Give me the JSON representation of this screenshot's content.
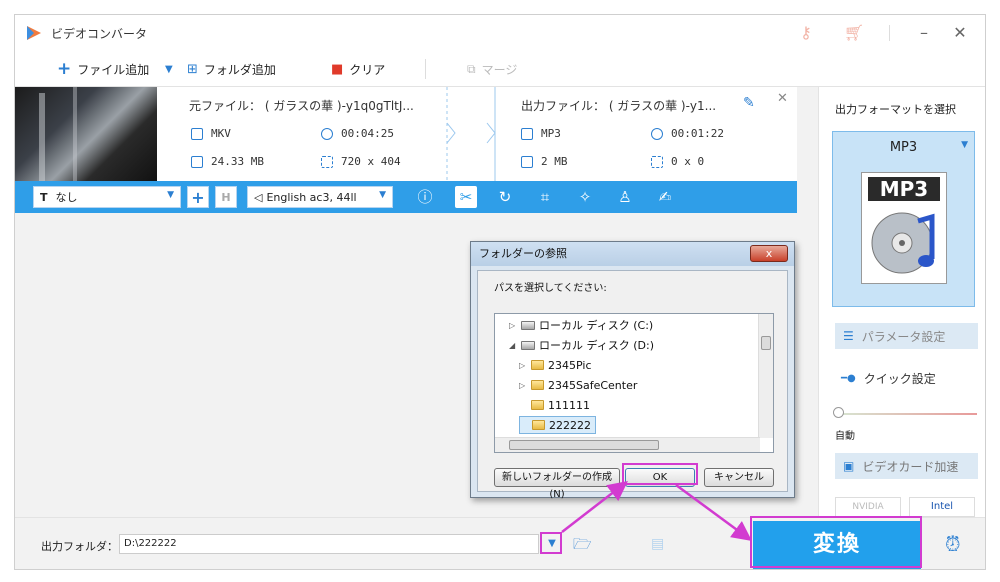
{
  "window": {
    "title": "ビデオコンバータ"
  },
  "toolbar": {
    "add_file": "ファイル追加",
    "add_folder": "フォルダ追加",
    "clear": "クリア",
    "merge": "マージ"
  },
  "file": {
    "source_label": "元ファイル： ( ガラスの華 )-y1q0gTltJ...",
    "source_format": "MKV",
    "source_duration": "00:04:25",
    "source_size": "24.33 MB",
    "source_resolution": "720 x 404",
    "output_label": "出力ファイル： ( ガラスの華 )-y1...",
    "output_format": "MP3",
    "output_duration": "00:01:22",
    "output_size": "2 MB",
    "output_resolution": "0 x 0"
  },
  "editbar": {
    "subtitle": "なし",
    "audio_track": "English ac3, 44ll"
  },
  "right_panel": {
    "format_heading": "出力フォーマットを選択",
    "format_name": "MP3",
    "format_badge": "MP3",
    "parameter_settings": "パラメータ設定",
    "quick_settings": "クイック設定",
    "auto_label": "自動",
    "gpu_accel": "ビデオカード加速",
    "nvidia": "NVIDIA",
    "intel": "Intel"
  },
  "bottom": {
    "output_folder_label": "出力フォルダ：",
    "output_folder_value": "D:\\222222",
    "convert": "変換"
  },
  "dialog": {
    "title": "フォルダーの参照",
    "close": "x",
    "instruction": "パスを選択してください:",
    "tree": [
      {
        "label": "ローカル ディスク (C:)",
        "type": "drive",
        "level": 1,
        "expander": "▷"
      },
      {
        "label": "ローカル ディスク (D:)",
        "type": "drive",
        "level": 1,
        "expander": "◢"
      },
      {
        "label": "2345Pic",
        "type": "folder",
        "level": 2,
        "expander": "▷"
      },
      {
        "label": "2345SafeCenter",
        "type": "folder",
        "level": 2,
        "expander": "▷"
      },
      {
        "label": "111111",
        "type": "folder",
        "level": 2,
        "expander": ""
      },
      {
        "label": "222222",
        "type": "folder",
        "level": 2,
        "expander": "",
        "selected": true
      }
    ],
    "new_folder": "新しいフォルダーの作成(N)",
    "ok": "OK",
    "cancel": "キャンセル"
  },
  "colors": {
    "accent": "#2f9ee8",
    "convert_bg": "#22a0ec",
    "highlight": "#d23bd0"
  }
}
